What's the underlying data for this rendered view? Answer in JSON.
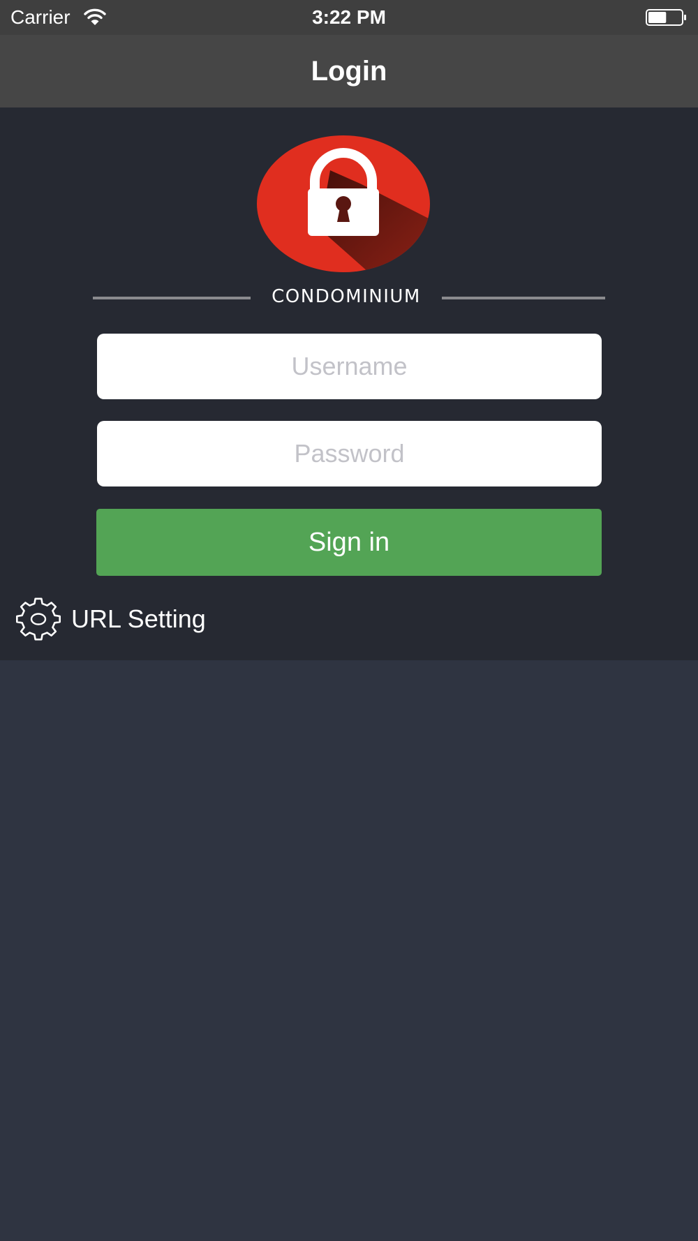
{
  "status_bar": {
    "carrier": "Carrier",
    "time": "3:22 PM",
    "wifi_icon": "wifi-icon",
    "battery_icon": "battery-icon",
    "battery_level": 0.55
  },
  "nav": {
    "title": "Login"
  },
  "logo": {
    "icon": "padlock-icon",
    "brand": "CONDOMINIUM",
    "colors": {
      "circle": "#e02e1f",
      "shadow": "#5a1711",
      "lock": "#ffffff"
    }
  },
  "form": {
    "username_placeholder": "Username",
    "username_value": "",
    "password_placeholder": "Password",
    "password_value": "",
    "signin_label": "Sign in"
  },
  "url_setting": {
    "icon": "gear-icon",
    "label": "URL Setting"
  },
  "colors": {
    "status_bar_bg": "#3f3f3f",
    "nav_bg": "#464646",
    "panel_bg": "#262932",
    "page_bg": "#2f3441",
    "signin_bg": "#53a455",
    "placeholder": "#c2c2c8"
  }
}
